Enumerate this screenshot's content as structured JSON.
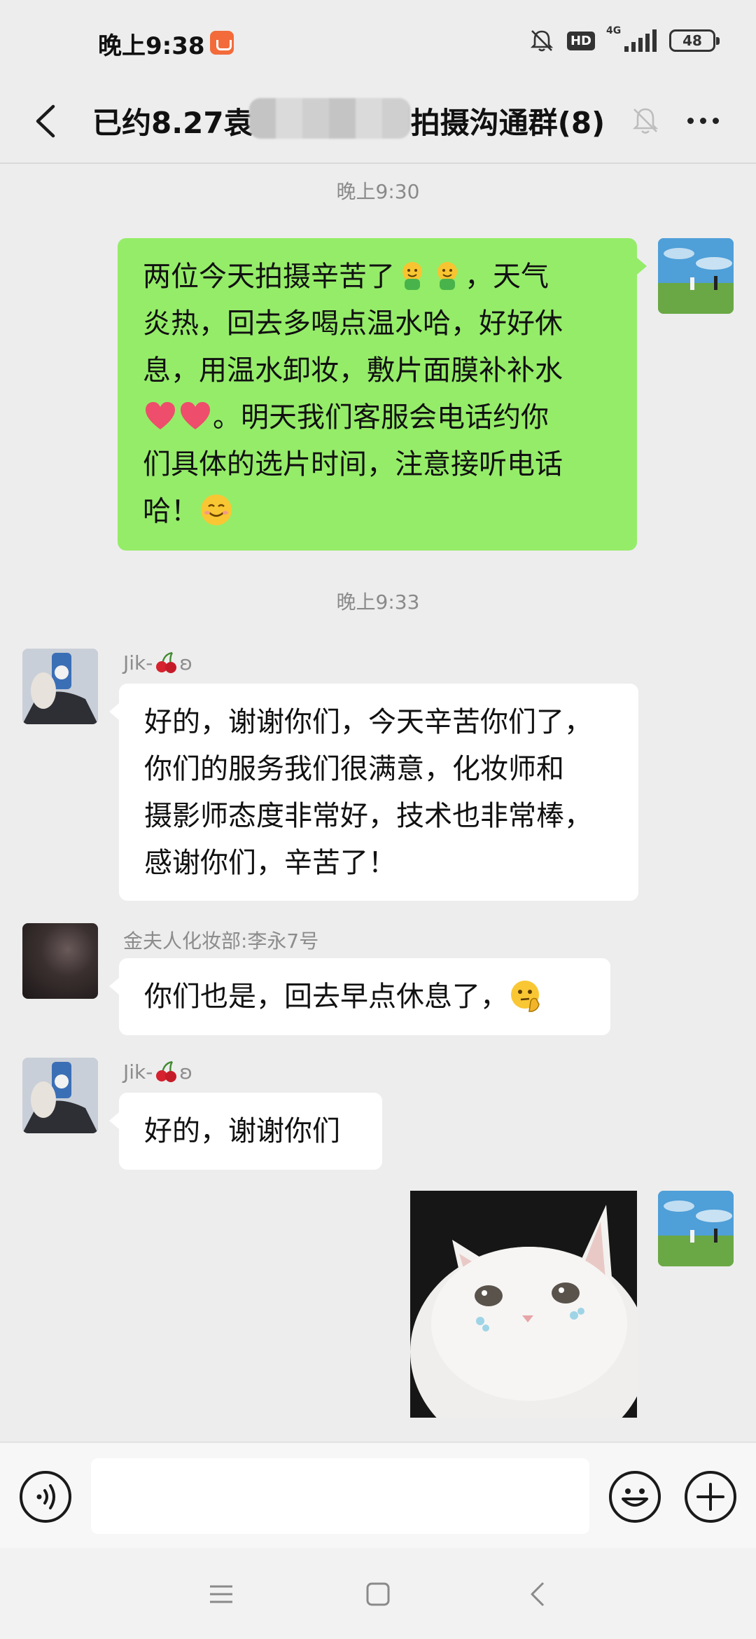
{
  "status": {
    "time": "晚上9:38",
    "hd": "HD",
    "network": "4G",
    "battery": "48"
  },
  "header": {
    "title_prefix": "已约8.27袁",
    "title_suffix": "拍摄沟通群(8)"
  },
  "messages": {
    "ts1": "晚上9:30",
    "m1": {
      "line1": "两位今天拍摄辛苦了",
      "line1_end": "，天气",
      "line2": "炎热，回去多喝点温水哈，好好休",
      "line3": "息，用温水卸妆，敷片面膜补补水",
      "line4_end": "。明天我们客服会电话约你",
      "line5": "们具体的选片时间，注意接听电话",
      "line6": "哈！"
    },
    "ts2": "晚上9:33",
    "m2": {
      "sender_prefix": "Jik-",
      "sender_suffix": "ʚ",
      "line1": "好的，谢谢你们，今天辛苦你们了，",
      "line2": "你们的服务我们很满意，化妆师和",
      "line3": "摄影师态度非常好，技术也非常棒，",
      "line4": "感谢你们，辛苦了！"
    },
    "m3": {
      "sender": "金夫人化妆部:李永7号",
      "text": "你们也是，回去早点休息了，"
    },
    "m4": {
      "sender_prefix": "Jik-",
      "sender_suffix": "ʚ",
      "text": "好的，谢谢你们"
    }
  },
  "input": {
    "value": ""
  },
  "colors": {
    "outgoing_bubble": "#95ec69",
    "incoming_bubble": "#ffffff",
    "background": "#ededed"
  },
  "icons": [
    "back-arrow-icon",
    "mute-bell-icon",
    "more-icon",
    "voice-icon",
    "emoji-icon",
    "plus-icon",
    "menu-icon",
    "home-icon",
    "nav-back-icon"
  ]
}
